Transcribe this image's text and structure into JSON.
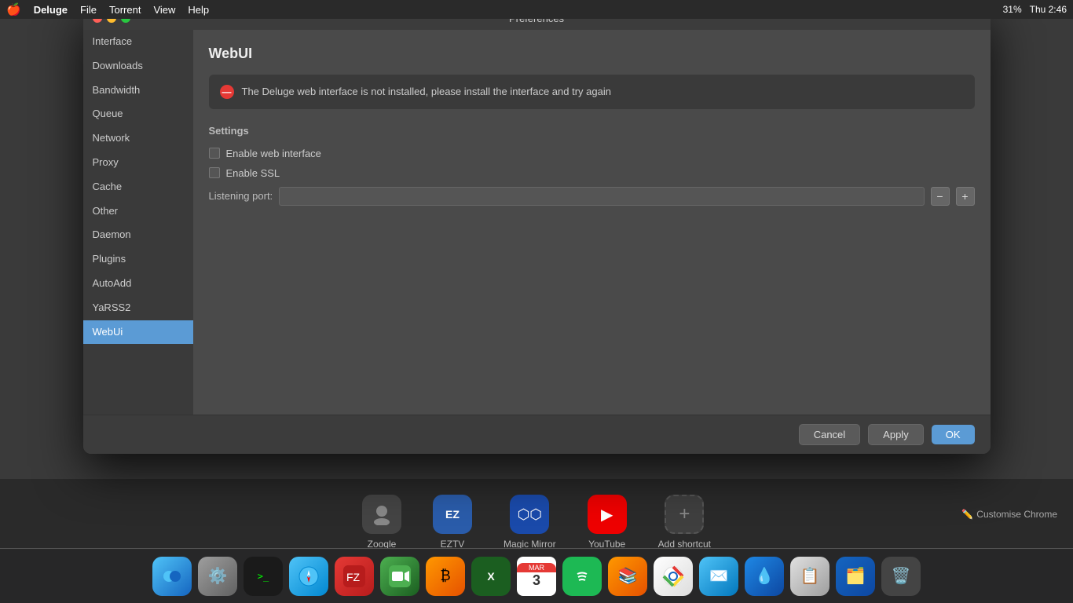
{
  "menubar": {
    "apple": "🍎",
    "app_name": "Deluge",
    "menus": [
      "File",
      "Torrent",
      "View",
      "Help"
    ],
    "right": {
      "time": "Thu 2:46",
      "battery": "31%"
    }
  },
  "preferences": {
    "title": "Preferences",
    "sidebar_items": [
      {
        "id": "interface",
        "label": "Interface"
      },
      {
        "id": "downloads",
        "label": "Downloads"
      },
      {
        "id": "bandwidth",
        "label": "Bandwidth"
      },
      {
        "id": "queue",
        "label": "Queue"
      },
      {
        "id": "network",
        "label": "Network"
      },
      {
        "id": "proxy",
        "label": "Proxy"
      },
      {
        "id": "cache",
        "label": "Cache"
      },
      {
        "id": "other",
        "label": "Other"
      },
      {
        "id": "daemon",
        "label": "Daemon"
      },
      {
        "id": "plugins",
        "label": "Plugins"
      },
      {
        "id": "autoadd",
        "label": "AutoAdd"
      },
      {
        "id": "yarss2",
        "label": "YaRSS2"
      },
      {
        "id": "webui",
        "label": "WebUi"
      }
    ],
    "active_item": "webui",
    "webui_section": {
      "title": "WebUI",
      "error_message": "The Deluge web interface is not installed, please install the interface and try again",
      "settings_label": "Settings",
      "enable_web_interface_label": "Enable web interface",
      "enable_ssl_label": "Enable SSL",
      "listening_port_label": "Listening port:",
      "listening_port_value": ""
    },
    "buttons": {
      "cancel": "Cancel",
      "apply": "Apply",
      "ok": "OK"
    }
  },
  "dock_shortcuts": [
    {
      "id": "zooqle",
      "label": "Zooqle",
      "icon": "🔍"
    },
    {
      "id": "eztv",
      "label": "EZTV",
      "icon": "EZ"
    },
    {
      "id": "magicmirror",
      "label": "Magic Mirror",
      "icon": "⬡⬡"
    },
    {
      "id": "youtube",
      "label": "YouTube",
      "icon": "▶"
    },
    {
      "id": "addshortcut",
      "label": "Add shortcut",
      "icon": "+"
    }
  ],
  "customise_chrome": "Customise Chrome",
  "mac_dock": [
    {
      "id": "finder",
      "label": "Finder"
    },
    {
      "id": "system-preferences",
      "label": "System Preferences"
    },
    {
      "id": "terminal",
      "label": "Terminal"
    },
    {
      "id": "safari",
      "label": "Safari"
    },
    {
      "id": "filezilla",
      "label": "FileZilla"
    },
    {
      "id": "facetime",
      "label": "FaceTime"
    },
    {
      "id": "bitcoin",
      "label": "Bitcoin"
    },
    {
      "id": "excel",
      "label": "Excel"
    },
    {
      "id": "calendar",
      "label": "Calendar",
      "date": "MAR",
      "day": "3"
    },
    {
      "id": "spotify",
      "label": "Spotify"
    },
    {
      "id": "books",
      "label": "Books"
    },
    {
      "id": "chrome",
      "label": "Chrome"
    },
    {
      "id": "mail",
      "label": "Mail"
    },
    {
      "id": "deluge",
      "label": "Deluge"
    },
    {
      "id": "paste",
      "label": "Paste"
    },
    {
      "id": "files",
      "label": "Files"
    },
    {
      "id": "trash",
      "label": "Trash"
    }
  ]
}
